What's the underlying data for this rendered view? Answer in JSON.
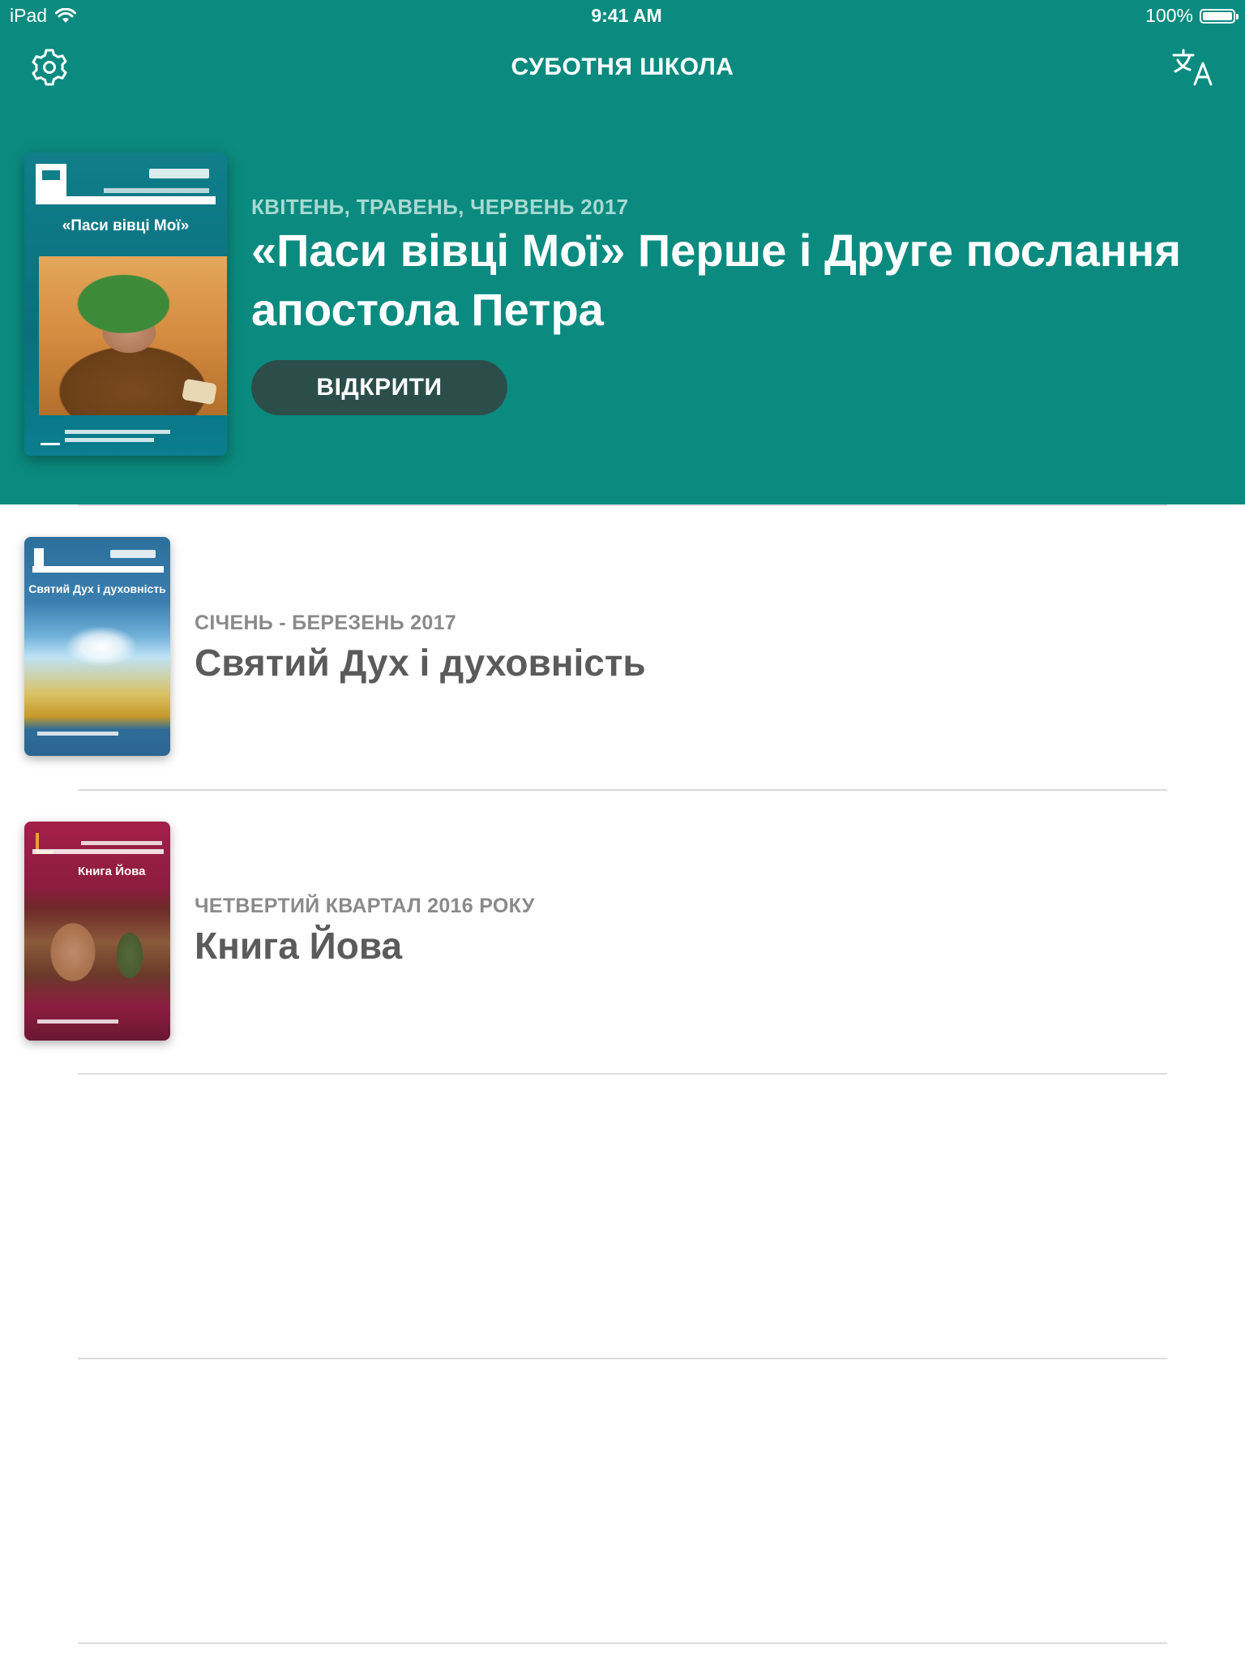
{
  "status_bar": {
    "device": "iPad",
    "time": "9:41 AM",
    "battery": "100%"
  },
  "nav": {
    "title": "СУБОТНЯ ШКОЛА",
    "left_icon": "settings-gear-icon",
    "right_icon": "translate-icon"
  },
  "featured": {
    "period": "КВІТЕНЬ, ТРАВЕНЬ, ЧЕРВЕНЬ 2017",
    "title": "«Паси вівці Мої» Перше і Друге послання апостола Петра",
    "open_label": "ВІДКРИТИ",
    "cover_title": "«Паси вівці Мої»",
    "colors": {
      "background": "#0b8b7f",
      "button": "#2c4e4b"
    }
  },
  "list": {
    "items": [
      {
        "period": "СІЧЕНЬ - БЕРЕЗЕНЬ 2017",
        "title": "Святий Дух і духовність",
        "cover_title": "Святий Дух і духовність"
      },
      {
        "period": "ЧЕТВЕРТИЙ КВАРТАЛ 2016 РОКУ",
        "title": "Книга Йова",
        "cover_title": "Книга Йова"
      }
    ]
  }
}
